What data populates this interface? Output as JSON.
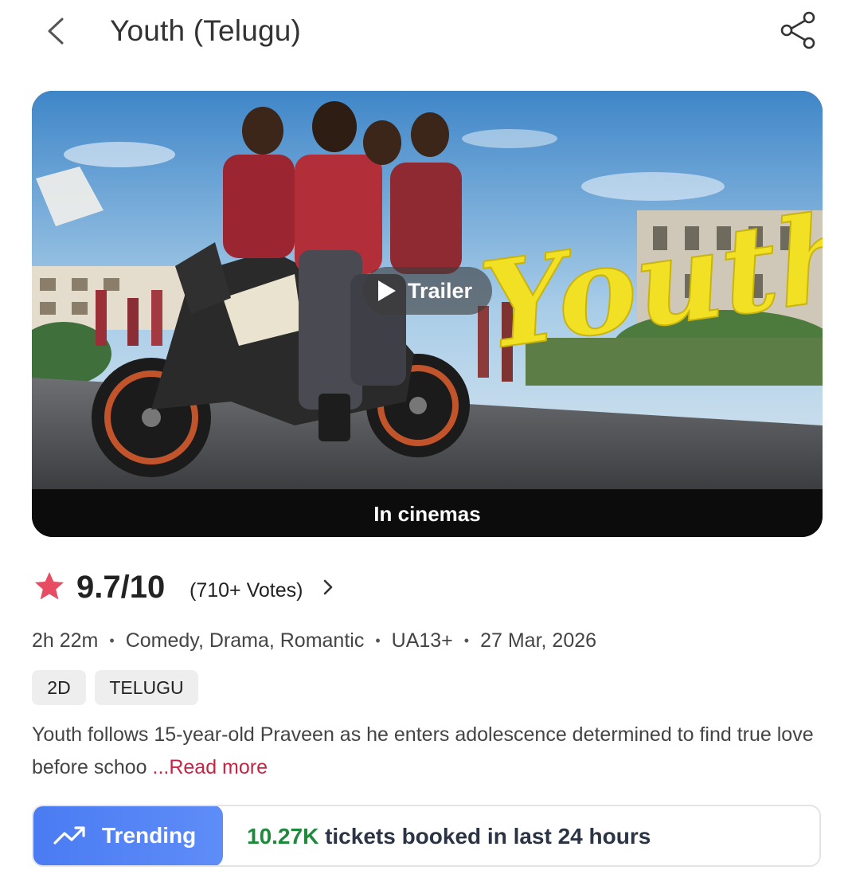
{
  "header": {
    "title": "Youth (Telugu)",
    "back_icon": "chevron-left-icon",
    "share_icon": "share-icon"
  },
  "poster": {
    "logo_text": "Youth",
    "trailer_label": "Trailer",
    "status_label": "In cinemas"
  },
  "rating": {
    "score": "9.7/10",
    "votes": "(710+ Votes)",
    "star_color": "#e74c62"
  },
  "meta": {
    "duration": "2h 22m",
    "genres": "Comedy, Drama, Romantic",
    "certificate": "UA13+",
    "release_date": "27 Mar, 2026",
    "separator": "•"
  },
  "tags": [
    "2D",
    "TELUGU"
  ],
  "synopsis": {
    "text": "Youth follows 15-year-old Praveen as he enters adolescence determined to find true love before schoo ",
    "read_more": "...Read more"
  },
  "trending": {
    "label": "Trending",
    "count": "10.27K",
    "text": " tickets booked in last 24 hours",
    "accent": "#4a7bf2",
    "count_color": "#1f8a3b"
  }
}
